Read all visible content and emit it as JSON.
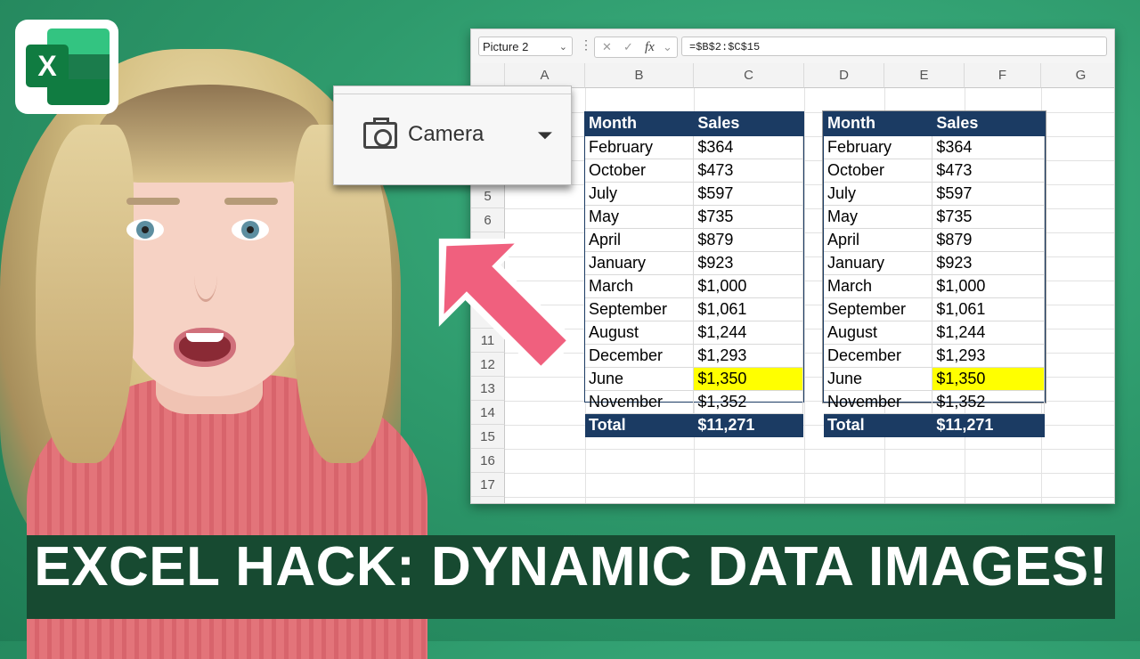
{
  "logo": {
    "letter": "X"
  },
  "formula_bar": {
    "name_box": "Picture 2",
    "name_box_caret": "⌄",
    "vdots": "⋮",
    "cancel_icon": "✕",
    "enter_icon": "✓",
    "fx_label": "fx",
    "fx_caret": "⌄",
    "formula": "=$B$2:$C$15"
  },
  "columns": [
    "A",
    "B",
    "C",
    "D",
    "E",
    "F",
    "G"
  ],
  "rows": [
    "5",
    "6",
    "11",
    "12",
    "13",
    "14",
    "15",
    "16",
    "17"
  ],
  "camera_popup": {
    "label": "Camera",
    "expand_glyph": "⏷"
  },
  "table_left": {
    "header": {
      "month": "Month",
      "sales": "Sales"
    },
    "rows": [
      {
        "month": "February",
        "sales": "$364"
      },
      {
        "month": "October",
        "sales": "$473"
      },
      {
        "month": "July",
        "sales": "$597"
      },
      {
        "month": "May",
        "sales": "$735"
      },
      {
        "month": "April",
        "sales": "$879"
      },
      {
        "month": "January",
        "sales": "$923"
      },
      {
        "month": "March",
        "sales": "$1,000"
      },
      {
        "month": "September",
        "sales": "$1,061"
      },
      {
        "month": "August",
        "sales": "$1,244"
      },
      {
        "month": "December",
        "sales": "$1,293"
      },
      {
        "month": "June",
        "sales": "$1,350",
        "highlight": true
      },
      {
        "month": "November",
        "sales": "$1,352"
      }
    ],
    "total": {
      "label": "Total",
      "value": "$11,271"
    }
  },
  "table_right": {
    "header": {
      "month": "Month",
      "sales": "Sales"
    },
    "rows": [
      {
        "month": "February",
        "sales": "$364"
      },
      {
        "month": "October",
        "sales": "$473"
      },
      {
        "month": "July",
        "sales": "$597"
      },
      {
        "month": "May",
        "sales": "$735"
      },
      {
        "month": "April",
        "sales": "$879"
      },
      {
        "month": "January",
        "sales": "$923"
      },
      {
        "month": "March",
        "sales": "$1,000"
      },
      {
        "month": "September",
        "sales": "$1,061"
      },
      {
        "month": "August",
        "sales": "$1,244"
      },
      {
        "month": "December",
        "sales": "$1,293"
      },
      {
        "month": "June",
        "sales": "$1,350",
        "highlight": true
      },
      {
        "month": "November",
        "sales": "$1,352"
      }
    ],
    "total": {
      "label": "Total",
      "value": "$11,271"
    }
  },
  "banner": {
    "text": "EXCEL HACK: DYNAMIC DATA IMAGES!"
  },
  "colors": {
    "table_header": "#1b3b63",
    "highlight": "#ffff00",
    "arrow": "#f0607e",
    "banner_bg": "#174a31",
    "background": "#2e9a6c"
  }
}
